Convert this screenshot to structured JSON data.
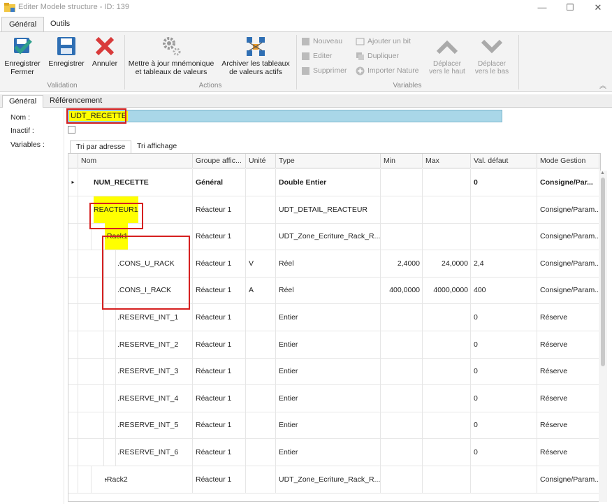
{
  "window": {
    "title": "Editer Modele structure - ID: 139",
    "minimize": "—",
    "maximize": "☐",
    "close": "✕"
  },
  "ribbon_tabs": [
    "Général",
    "Outils"
  ],
  "ribbon": {
    "validation": {
      "label": "Validation",
      "save_close": "Enregistrer\nFermer",
      "save": "Enregistrer",
      "cancel": "Annuler"
    },
    "actions": {
      "label": "Actions",
      "update": "Mettre à jour mnémonique\net tableaux de valeurs",
      "archive": "Archiver les tableaux\nde valeurs actifs"
    },
    "variables": {
      "label": "Variables",
      "new": "Nouveau",
      "edit": "Editer",
      "delete": "Supprimer",
      "add_bit": "Ajouter un bit",
      "duplicate": "Dupliquer",
      "import_nature": "Importer Nature",
      "move_up": "Déplacer\nvers le haut",
      "move_down": "Déplacer\nvers le bas"
    }
  },
  "sub_tabs": [
    "Général",
    "Référencement"
  ],
  "form": {
    "name_label": "Nom :",
    "name_value": "UDT_RECETTE",
    "inactive_label": "Inactif :",
    "variables_label": "Variables :"
  },
  "grid_tabs": [
    "Tri par adresse",
    "Tri affichage"
  ],
  "grid": {
    "columns": [
      "Nom",
      "Groupe affic...",
      "Unité",
      "Type",
      "Min",
      "Max",
      "Val. défaut",
      "Mode Gestion"
    ],
    "rows": [
      {
        "name": "NUM_RECETTE",
        "group": "Général",
        "unit": "",
        "type": "Double Entier",
        "min": "",
        "max": "",
        "default": "0",
        "mode": "Consigne/Par...",
        "indicator": "▸",
        "expander": ""
      },
      {
        "name": "REACTEUR1",
        "group": "Réacteur 1",
        "unit": "",
        "type": "UDT_DETAIL_REACTEUR",
        "min": "",
        "max": "",
        "default": "",
        "mode": "Consigne/Param...",
        "indicator": "",
        "expander": "▾"
      },
      {
        "name": ".Rack1",
        "group": "Réacteur 1",
        "unit": "",
        "type": "UDT_Zone_Ecriture_Rack_R...",
        "min": "",
        "max": "",
        "default": "",
        "mode": "Consigne/Param...",
        "indicator": "",
        "expander": "▾"
      },
      {
        "name": ".CONS_U_RACK",
        "group": "Réacteur 1",
        "unit": "V",
        "type": "Réel",
        "min": "2,4000",
        "max": "24,0000",
        "default": "2,4",
        "mode": "Consigne/Param...",
        "indicator": "",
        "expander": ""
      },
      {
        "name": ".CONS_I_RACK",
        "group": "Réacteur 1",
        "unit": "A",
        "type": "Réel",
        "min": "400,0000",
        "max": "4000,0000",
        "default": "400",
        "mode": "Consigne/Param...",
        "indicator": "",
        "expander": ""
      },
      {
        "name": ".RESERVE_INT_1",
        "group": "Réacteur 1",
        "unit": "",
        "type": "Entier",
        "min": "",
        "max": "",
        "default": "0",
        "mode": "Réserve",
        "indicator": "",
        "expander": ""
      },
      {
        "name": ".RESERVE_INT_2",
        "group": "Réacteur 1",
        "unit": "",
        "type": "Entier",
        "min": "",
        "max": "",
        "default": "0",
        "mode": "Réserve",
        "indicator": "",
        "expander": ""
      },
      {
        "name": ".RESERVE_INT_3",
        "group": "Réacteur 1",
        "unit": "",
        "type": "Entier",
        "min": "",
        "max": "",
        "default": "0",
        "mode": "Réserve",
        "indicator": "",
        "expander": ""
      },
      {
        "name": ".RESERVE_INT_4",
        "group": "Réacteur 1",
        "unit": "",
        "type": "Entier",
        "min": "",
        "max": "",
        "default": "0",
        "mode": "Réserve",
        "indicator": "",
        "expander": ""
      },
      {
        "name": ".RESERVE_INT_5",
        "group": "Réacteur 1",
        "unit": "",
        "type": "Entier",
        "min": "",
        "max": "",
        "default": "0",
        "mode": "Réserve",
        "indicator": "",
        "expander": ""
      },
      {
        "name": ".RESERVE_INT_6",
        "group": "Réacteur 1",
        "unit": "",
        "type": "Entier",
        "min": "",
        "max": "",
        "default": "0",
        "mode": "Réserve",
        "indicator": "",
        "expander": ""
      },
      {
        "name": ".Rack2",
        "group": "Réacteur 1",
        "unit": "",
        "type": "UDT_Zone_Ecriture_Rack_R...",
        "min": "",
        "max": "",
        "default": "",
        "mode": "Consigne/Param...",
        "indicator": "",
        "expander": "▸"
      }
    ]
  },
  "colors": {
    "highlight": "#ffff00",
    "annotation_red": "#d62020",
    "name_field_bg": "#a9d7e8",
    "save_icon": "#2f6fb4",
    "cancel_icon": "#d93b3b",
    "check_icon": "#2e9f8c"
  }
}
